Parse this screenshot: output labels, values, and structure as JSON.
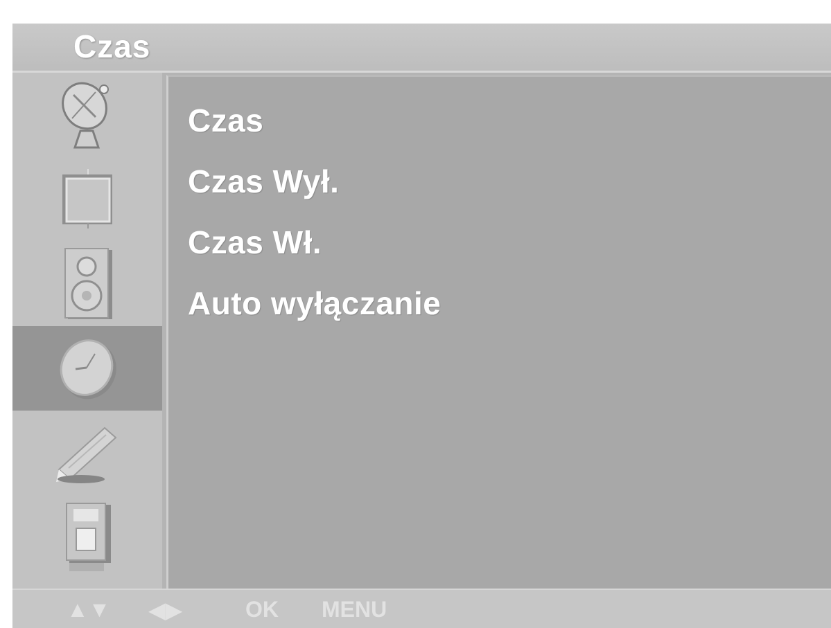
{
  "header": {
    "title": "Czas"
  },
  "sidebar": {
    "items": [
      {
        "icon": "satellite-dish-icon",
        "active": false
      },
      {
        "icon": "picture-screen-icon",
        "active": false
      },
      {
        "icon": "speaker-icon",
        "active": false
      },
      {
        "icon": "clock-icon",
        "active": true
      },
      {
        "icon": "pencil-icon",
        "active": false
      },
      {
        "icon": "input-source-icon",
        "active": false
      }
    ]
  },
  "menu": {
    "items": [
      {
        "label": "Czas"
      },
      {
        "label": "Czas Wył."
      },
      {
        "label": "Czas Wł."
      },
      {
        "label": "Auto wyłączanie"
      }
    ]
  },
  "footer": {
    "hints": [
      {
        "label": "▲▼"
      },
      {
        "label": "◀▶"
      },
      {
        "label": "OK"
      },
      {
        "label": "MENU"
      }
    ]
  },
  "colors": {
    "panel": "#a8a8a8",
    "sidebar": "#c2c2c2",
    "active_item": "#959595",
    "text": "#ffffff"
  }
}
